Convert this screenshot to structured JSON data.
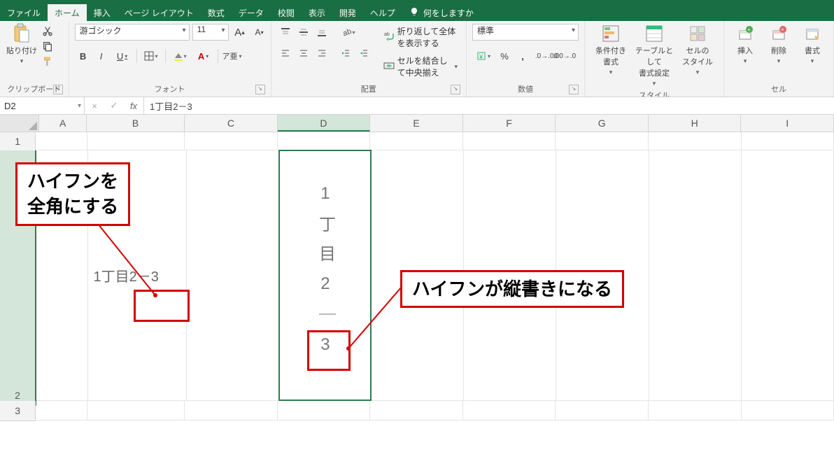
{
  "tabs": {
    "file": "ファイル",
    "home": "ホーム",
    "insert": "挿入",
    "pageLayout": "ページ レイアウト",
    "formulas": "数式",
    "data": "データ",
    "review": "校閲",
    "view": "表示",
    "developer": "開発",
    "help": "ヘルプ",
    "tellme": "何をしますか"
  },
  "ribbon": {
    "clipboard": {
      "paste": "貼り付け",
      "label": "クリップボード"
    },
    "font": {
      "name": "游ゴシック",
      "size": "11",
      "bold": "B",
      "italic": "I",
      "underline": "U",
      "label": "フォント"
    },
    "alignment": {
      "wrap": "折り返して全体を表示する",
      "merge": "セルを結合して中央揃え",
      "label": "配置"
    },
    "number": {
      "format": "標準",
      "label": "数値"
    },
    "styles": {
      "cond": "条件付き\n書式",
      "table": "テーブルとして\n書式設定",
      "cell": "セルの\nスタイル",
      "label": "スタイル"
    },
    "cells": {
      "insert": "挿入",
      "delete": "削除",
      "format": "書式",
      "label": "セル"
    }
  },
  "namebox": "D2",
  "formula": "1丁目2－3",
  "columns": [
    "A",
    "B",
    "C",
    "D",
    "E",
    "F",
    "G",
    "H",
    "I"
  ],
  "rows": [
    "1",
    "2",
    "3"
  ],
  "cells": {
    "B2": "1丁目2－3",
    "D2_chars": "1丁目2｜3"
  },
  "callouts": {
    "c1_l1": "ハイフンを",
    "c1_l2": "全角にする",
    "c2": "ハイフンが縦書きになる"
  }
}
